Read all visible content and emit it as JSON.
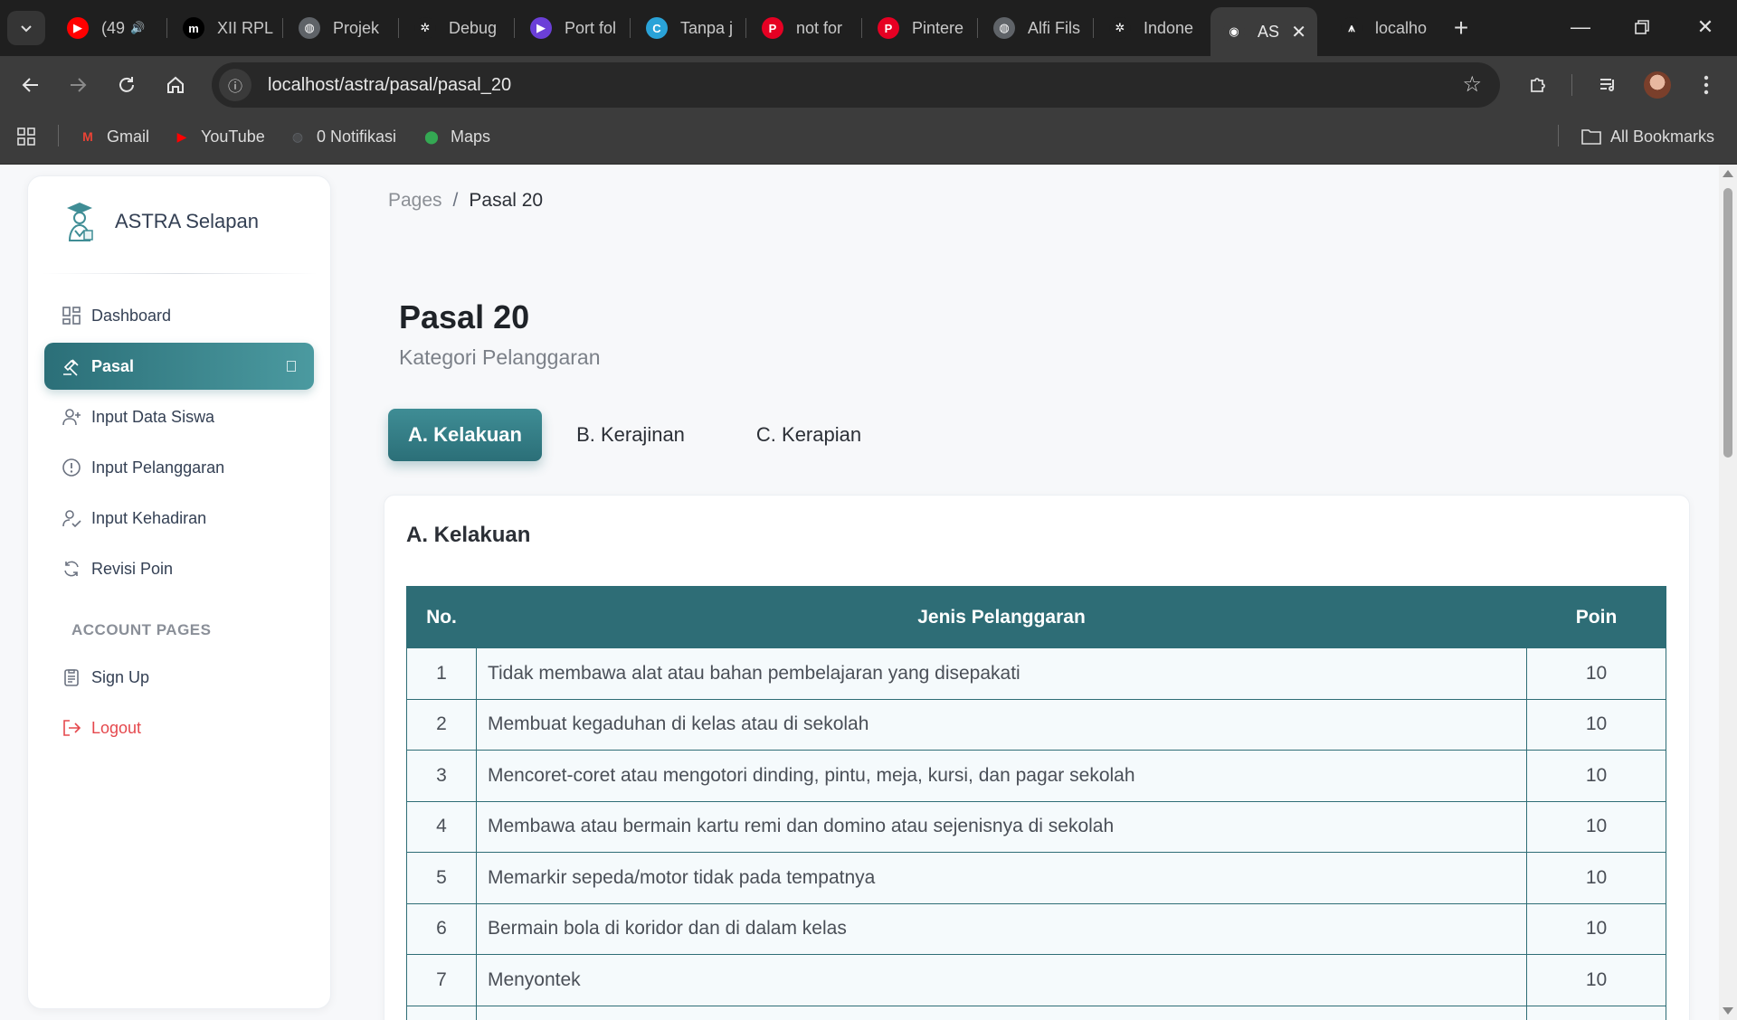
{
  "browser": {
    "tabs": [
      {
        "label": "(49",
        "icon": "youtube-icon",
        "color": "#ff0000",
        "glyph": "▶"
      },
      {
        "label": "XII RPL",
        "icon": "m-icon",
        "color": "#000000",
        "glyph": "m"
      },
      {
        "label": "Projek",
        "icon": "globe-icon",
        "color": "#5f6368",
        "glyph": "◍"
      },
      {
        "label": "Debug",
        "icon": "openai-icon",
        "color": "#1f1f1f",
        "glyph": "✲"
      },
      {
        "label": "Port fol",
        "icon": "video-icon",
        "color": "#6b3fd8",
        "glyph": "▶"
      },
      {
        "label": "Tanpa j",
        "icon": "canva-icon",
        "color": "#2aa3d8",
        "glyph": "C"
      },
      {
        "label": "not for",
        "icon": "pinterest-icon",
        "color": "#e60023",
        "glyph": "P"
      },
      {
        "label": "Pintere",
        "icon": "pinterest-icon",
        "color": "#e60023",
        "glyph": "P"
      },
      {
        "label": "Alfi Fils",
        "icon": "globe-icon",
        "color": "#5f6368",
        "glyph": "◍"
      },
      {
        "label": "Indone",
        "icon": "openai-icon",
        "color": "#1f1f1f",
        "glyph": "✲"
      },
      {
        "label": "AS",
        "icon": "astra-icon",
        "color": "#3c3c3c",
        "glyph": "◉"
      },
      {
        "label": "localho",
        "icon": "xampp-icon",
        "color": "#1f1f1f",
        "glyph": "⩚"
      }
    ],
    "url_host": "localhost",
    "url_path": "/astra/pasal/pasal_20",
    "bookmarks": [
      {
        "label": "Gmail",
        "icon": "gmail-icon",
        "color": "#ea4335",
        "glyph": "M"
      },
      {
        "label": "YouTube",
        "icon": "youtube-icon",
        "color": "#ff0000",
        "glyph": "▶"
      },
      {
        "label": "0 Notifikasi",
        "icon": "globe-icon",
        "color": "#5f6368",
        "glyph": "◍"
      },
      {
        "label": "Maps",
        "icon": "maps-icon",
        "color": "#34a853",
        "glyph": "⬤"
      }
    ],
    "all_bookmarks": "All Bookmarks"
  },
  "sidebar": {
    "brand": "ASTRA Selapan",
    "items": [
      {
        "label": "Dashboard",
        "icon": "dashboard-icon"
      },
      {
        "label": "Pasal",
        "icon": "gavel-icon"
      },
      {
        "label": "Input Data Siswa",
        "icon": "user-plus-icon"
      },
      {
        "label": "Input Pelanggaran",
        "icon": "alert-circle-icon"
      },
      {
        "label": "Input Kehadiran",
        "icon": "user-check-icon"
      },
      {
        "label": "Revisi Poin",
        "icon": "refresh-icon"
      }
    ],
    "section": "ACCOUNT PAGES",
    "account_items": [
      {
        "label": "Sign Up",
        "icon": "clipboard-icon"
      },
      {
        "label": "Logout",
        "icon": "logout-icon"
      }
    ]
  },
  "breadcrumb": {
    "root": "Pages",
    "sep": "/",
    "current": "Pasal 20"
  },
  "header": {
    "title": "Pasal 20",
    "subtitle": "Kategori Pelanggaran"
  },
  "tabs": [
    "A. Kelakuan",
    "B. Kerajinan",
    "C. Kerapian"
  ],
  "card": {
    "title": "A. Kelakuan",
    "columns": [
      "No.",
      "Jenis Pelanggaran",
      "Poin"
    ],
    "rows": [
      {
        "no": "1",
        "desc": "Tidak membawa alat atau bahan pembelajaran yang disepakati",
        "poin": "10"
      },
      {
        "no": "2",
        "desc": "Membuat kegaduhan di kelas atau di sekolah",
        "poin": "10"
      },
      {
        "no": "3",
        "desc": "Mencoret-coret atau mengotori dinding, pintu, meja, kursi, dan pagar sekolah",
        "poin": "10"
      },
      {
        "no": "4",
        "desc": "Membawa atau bermain kartu remi dan domino atau sejenisnya di sekolah",
        "poin": "10"
      },
      {
        "no": "5",
        "desc": "Memarkir sepeda/motor tidak pada tempatnya",
        "poin": "10"
      },
      {
        "no": "6",
        "desc": "Bermain bola di koridor dan di dalam kelas",
        "poin": "10"
      },
      {
        "no": "7",
        "desc": "Menyontek",
        "poin": "10"
      },
      {
        "no": "",
        "desc": "",
        "poin": ""
      }
    ]
  },
  "colors": {
    "accent": "#2e6d76",
    "logout": "#e5484d"
  }
}
